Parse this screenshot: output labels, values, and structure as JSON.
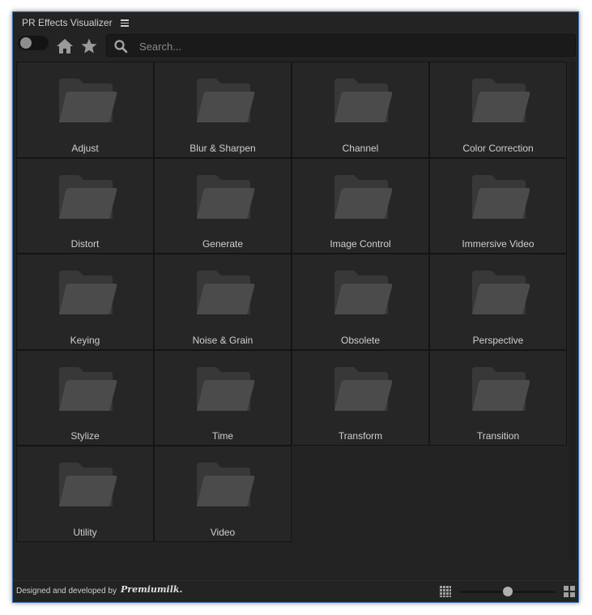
{
  "app": {
    "title": "PR Effects Visualizer",
    "menu_icon": "hamburger-menu-icon"
  },
  "toolbar": {
    "toggle_on": false,
    "home_icon": "home-icon",
    "star_icon": "star-icon",
    "search_icon": "search-icon",
    "search_placeholder": "Search...",
    "search_value": ""
  },
  "folders": [
    {
      "label": "Adjust"
    },
    {
      "label": "Blur & Sharpen"
    },
    {
      "label": "Channel"
    },
    {
      "label": "Color Correction"
    },
    {
      "label": "Distort"
    },
    {
      "label": "Generate"
    },
    {
      "label": "Image Control"
    },
    {
      "label": "Immersive Video"
    },
    {
      "label": "Keying"
    },
    {
      "label": "Noise & Grain"
    },
    {
      "label": "Obsolete"
    },
    {
      "label": "Perspective"
    },
    {
      "label": "Stylize"
    },
    {
      "label": "Time"
    },
    {
      "label": "Transform"
    },
    {
      "label": "Transition"
    },
    {
      "label": "Utility"
    },
    {
      "label": "Video"
    }
  ],
  "footer": {
    "credit": "Designed and developed by",
    "brand": "Premiumilk.",
    "zoom_fraction": 0.5
  },
  "colors": {
    "panel_bg": "#232323",
    "panel_border": "#3b6fb0",
    "folder_back": "#383838",
    "folder_front": "#4b4b4b"
  }
}
